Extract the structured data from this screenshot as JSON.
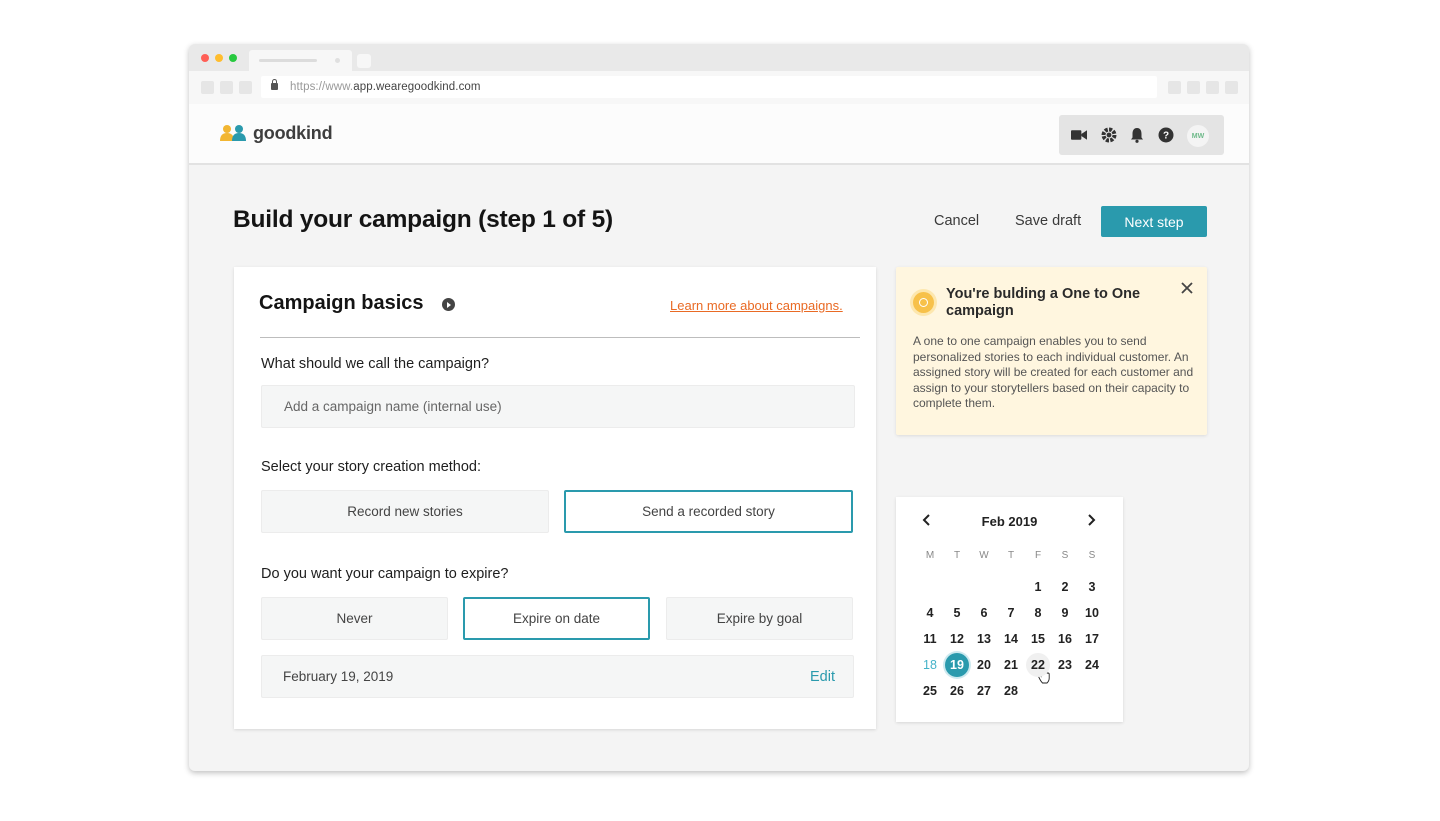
{
  "browser": {
    "url_protocol": "https://www.",
    "url_domain": "app.wearegoodkind.com"
  },
  "header": {
    "logo_text": "goodkind",
    "avatar_initials": "MW",
    "icons": [
      "video-camera-icon",
      "gear-icon",
      "bell-icon",
      "help-icon"
    ]
  },
  "page": {
    "title": "Build your campaign (step 1 of 5)",
    "cancel_label": "Cancel",
    "save_draft_label": "Save draft",
    "next_step_label": "Next step"
  },
  "card": {
    "title": "Campaign basics",
    "learn_more": "Learn more about campaigns.",
    "q_name": "What should we call the campaign?",
    "name_placeholder": "Add a campaign name (internal use)",
    "q_method": "Select your story creation method:",
    "method_options": [
      "Record new stories",
      "Send a recorded story"
    ],
    "method_selected": 1,
    "q_expire": "Do you want your campaign to expire?",
    "expire_options": [
      "Never",
      "Expire on date",
      "Expire by goal"
    ],
    "expire_selected": 1,
    "expire_date": "February 19, 2019",
    "edit_label": "Edit"
  },
  "info": {
    "title": "You're bulding a One to One campaign",
    "body": "A one to one campaign enables you to send personalized stories to each individual customer. An assigned story will be created for each customer and assign to your storytellers based on their capacity to complete them."
  },
  "calendar": {
    "month_label": "Feb 2019",
    "weekdays": [
      "M",
      "T",
      "W",
      "T",
      "F",
      "S",
      "S"
    ],
    "first_weekday_index": 4,
    "days_in_month": 28,
    "selected_day": 19,
    "hover_day": 22,
    "today_day": 18
  },
  "colors": {
    "accent": "#2a9aad",
    "link": "#e96a24",
    "info_bg": "#fff6df"
  }
}
